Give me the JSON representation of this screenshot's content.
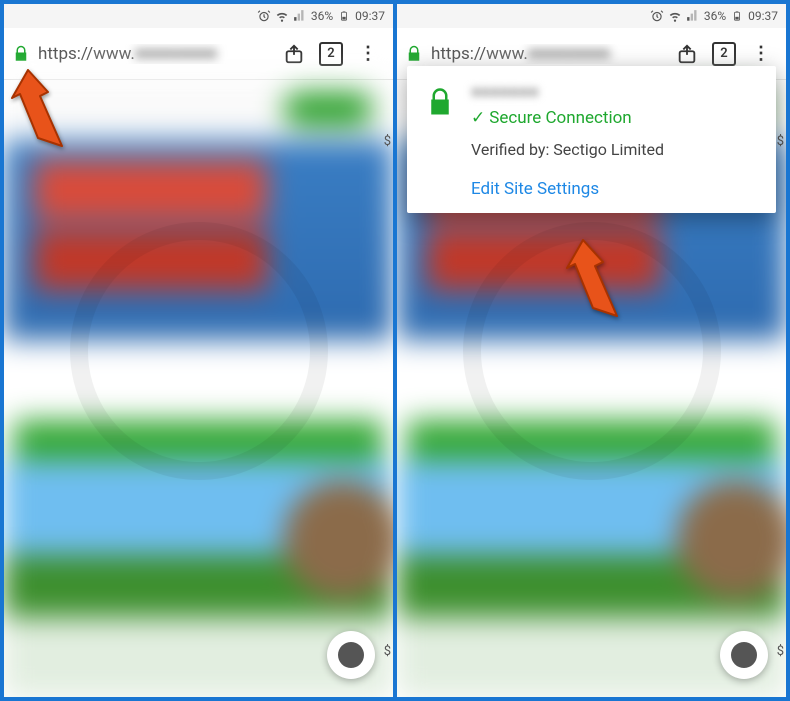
{
  "statusbar": {
    "battery_pct": "36%",
    "time": "09:37",
    "icons": [
      "alarm",
      "wifi",
      "signal",
      "battery"
    ]
  },
  "urlbar": {
    "scheme": "https://",
    "host_prefix": "www.",
    "host_blurred": "■■■■■■■■",
    "tab_count": "2"
  },
  "popover": {
    "sitename_blurred": "■■■■■■■",
    "secure_text": "Secure Connection",
    "verified_text": "Verified by: Sectigo Limited",
    "edit_link": "Edit Site Settings"
  },
  "marks": {
    "dollar": "$"
  }
}
